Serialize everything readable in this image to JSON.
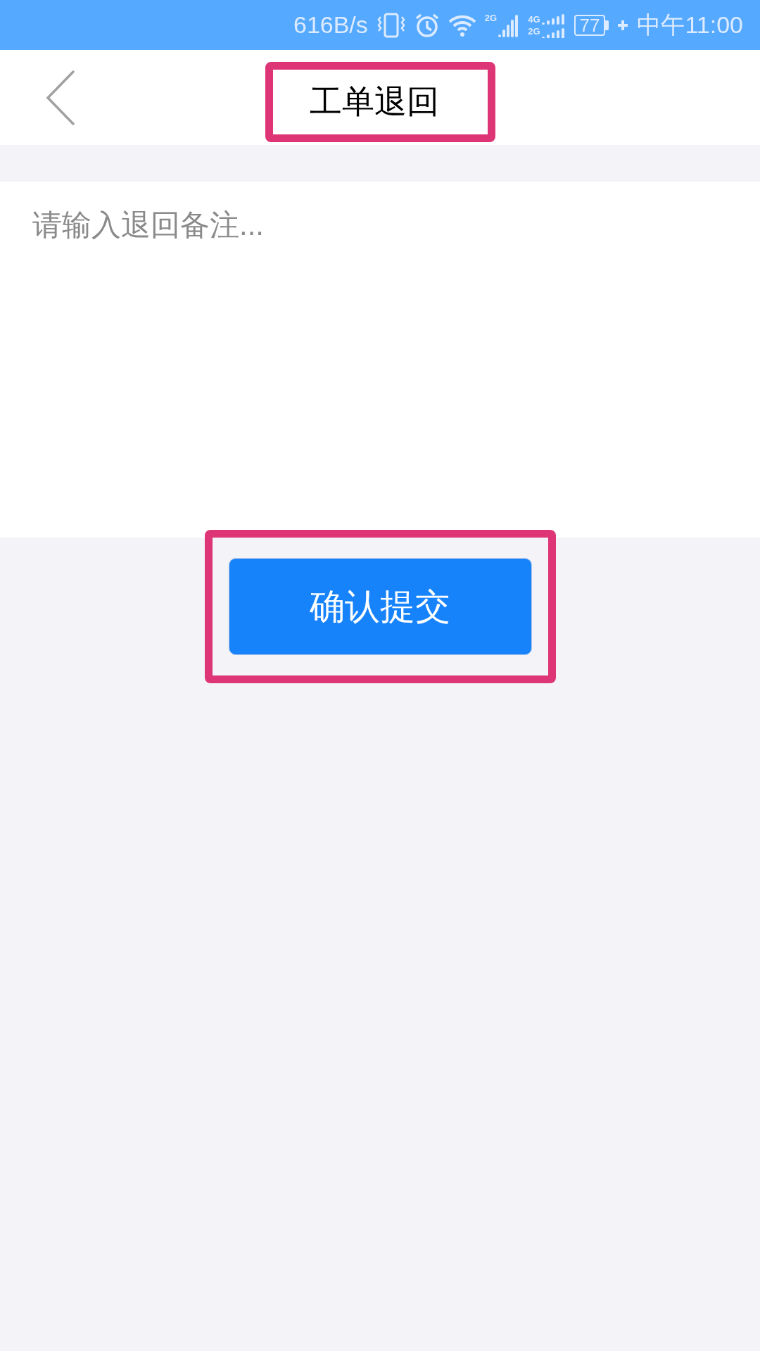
{
  "status_bar": {
    "network_speed": "616B/s",
    "signal_1_label": "2G",
    "signal_2_labels": [
      "4G",
      "2G"
    ],
    "battery": "77",
    "time": "中午11:00"
  },
  "header": {
    "title": "工单退回",
    "title_highlighted": true
  },
  "remark_field": {
    "placeholder": "请输入退回备注..."
  },
  "submit_button": {
    "label": "确认提交",
    "highlighted": true
  }
}
